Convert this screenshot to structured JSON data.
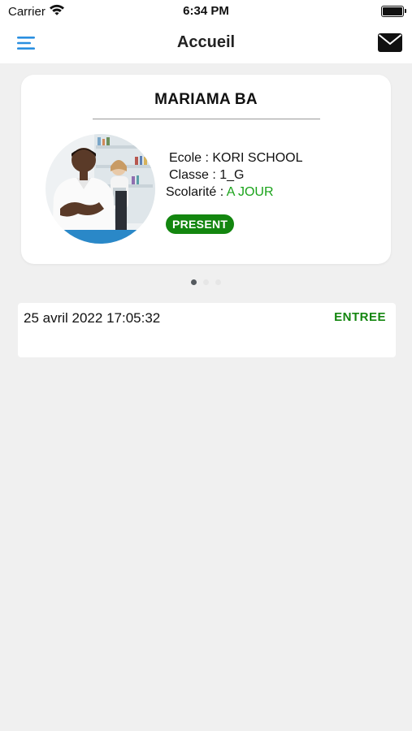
{
  "status_bar": {
    "carrier": "Carrier",
    "time": "6:34 PM"
  },
  "nav": {
    "title": "Accueil",
    "menu_icon": "hamburger-menu-icon",
    "mail_icon": "envelope-icon",
    "accent_color": "#2a8fe0"
  },
  "student_card": {
    "name": "MARIAMA BA",
    "school_label": "Ecole : KORI SCHOOL",
    "class_label": "Classe : 1_G",
    "tuition_label": "Scolarité : ",
    "tuition_status": "A JOUR",
    "tuition_status_color": "#1aa31a",
    "presence_badge": "PRESENT",
    "presence_badge_color": "#13860f"
  },
  "pager": {
    "pages": 3,
    "active_index": 0
  },
  "entries": [
    {
      "datetime": "25 avril 2022 17:05:32",
      "type": "ENTREE"
    }
  ]
}
